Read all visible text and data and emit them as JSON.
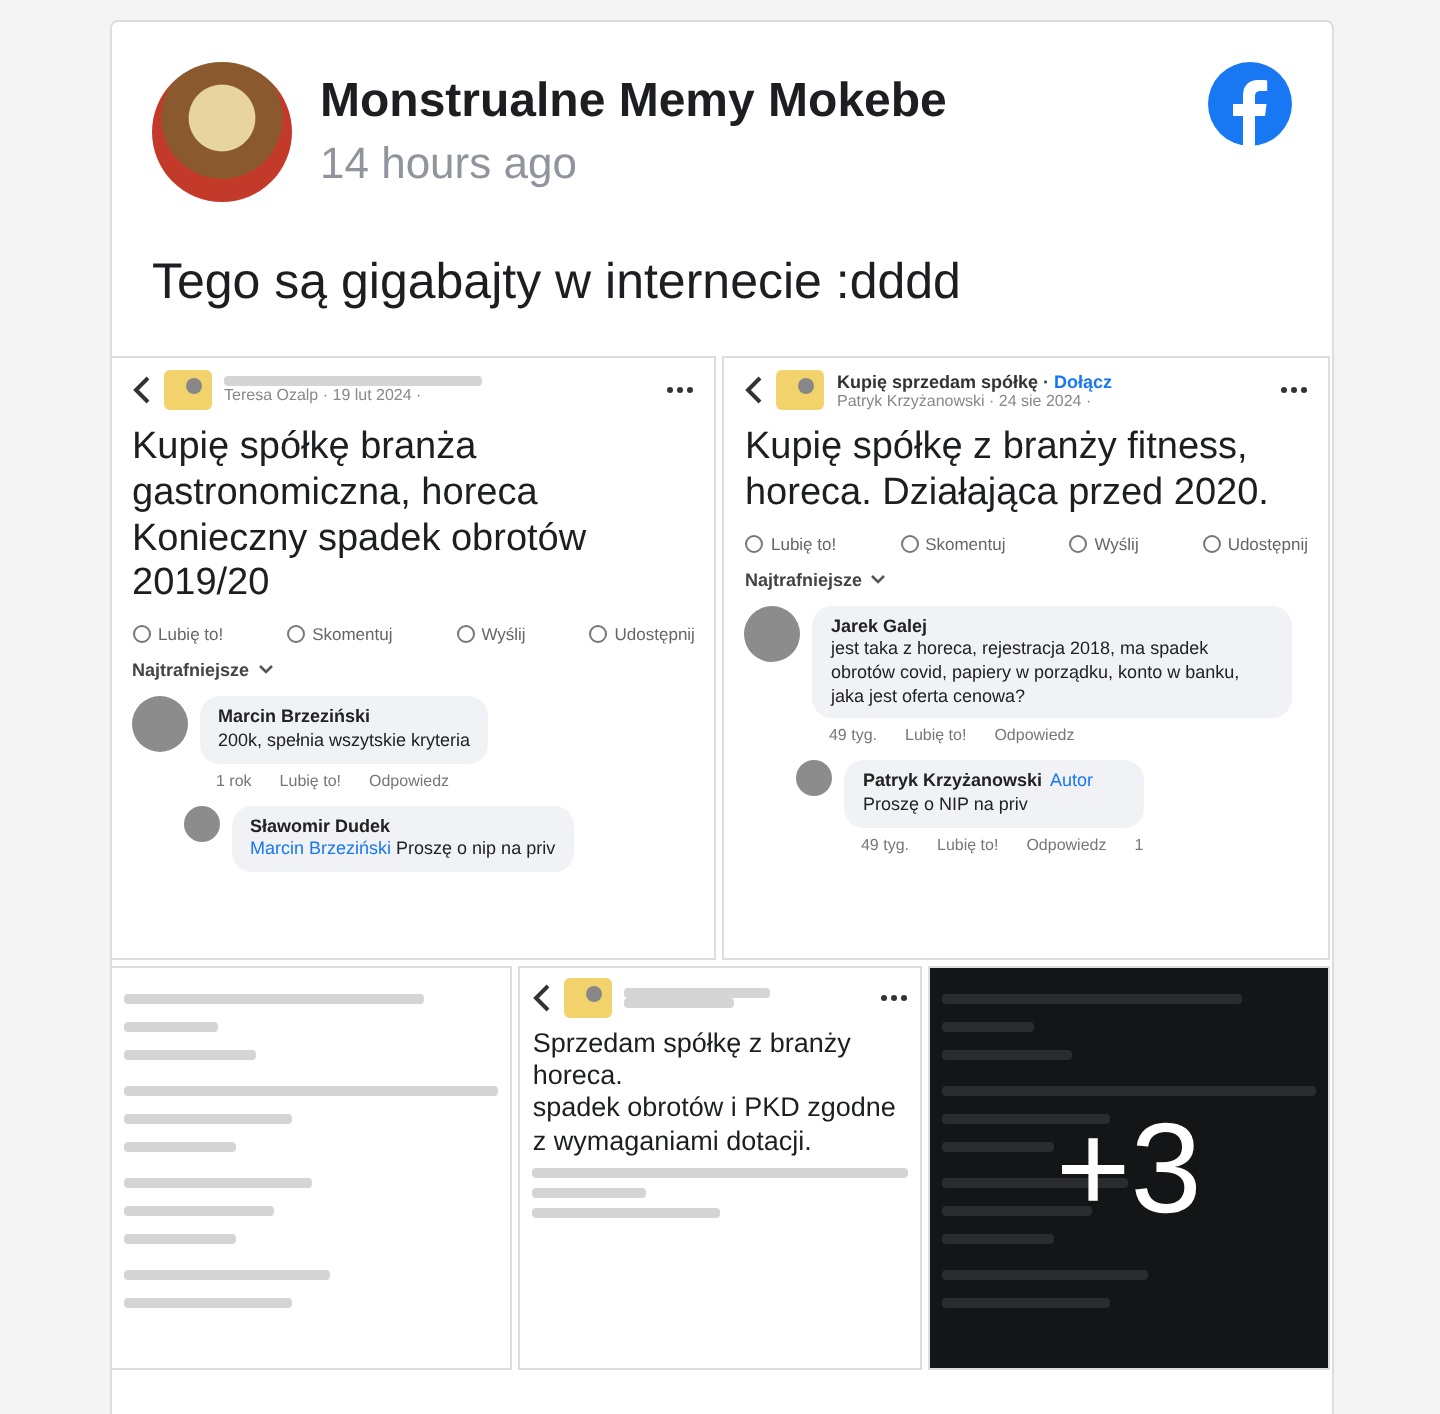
{
  "post": {
    "author": "Monstrualne Memy Mokebe",
    "time": "14 hours ago",
    "text": "Tego są gigabajty w internecie :dddd"
  },
  "images": [
    {
      "kind": "post",
      "byline": "Teresa Ozalp · 19 lut 2024 ·",
      "title": "Kupię spółkę branża gastronomiczna, horeca Konieczny spadek obrotów 2019/20",
      "actions": [
        "Lubię to!",
        "Skomentuj",
        "Wyślij",
        "Udostępnij"
      ],
      "sort": "Najtrafniejsze",
      "comments": [
        {
          "author": "Marcin Brzeziński",
          "text": "200k, spełnia wszytskie kryteria",
          "meta": [
            "1 rok",
            "Lubię to!",
            "Odpowiedz"
          ],
          "replies": [
            {
              "author": "Sławomir Dudek",
              "mention": "Marcin Brzeziński",
              "text": "Proszę o nip na priv"
            }
          ]
        }
      ]
    },
    {
      "kind": "post",
      "group": "Kupię sprzedam spółkę ·",
      "join": "Dołącz",
      "byline": "Patryk Krzyżanowski · 24 sie 2024 ·",
      "title": "Kupię spółkę z branży fitness, horeca. Działająca przed 2020.",
      "actions": [
        "Lubię to!",
        "Skomentuj",
        "Wyślij",
        "Udostępnij"
      ],
      "sort": "Najtrafniejsze",
      "comments": [
        {
          "author": "Jarek Galej",
          "text": "jest taka z horeca, rejestracja 2018, ma spadek obrotów covid, papiery w porządku, konto w banku, jaka jest oferta cenowa?",
          "meta": [
            "49 tyg.",
            "Lubię to!",
            "Odpowiedz"
          ],
          "replies": [
            {
              "author": "Patryk Krzyżanowski",
              "text": "Proszę o NIP na priv",
              "badge": "Autor",
              "meta": [
                "49 tyg.",
                "Lubię to!",
                "Odpowiedz"
              ],
              "reactions": "1"
            }
          ]
        }
      ]
    },
    {
      "kind": "blurred"
    },
    {
      "kind": "post",
      "title": "Sprzedam spółkę z branży horeca.\nspadek obrotów i PKD zgodne z wymaganiami dotacji."
    },
    {
      "kind": "more",
      "more": "+3"
    }
  ]
}
